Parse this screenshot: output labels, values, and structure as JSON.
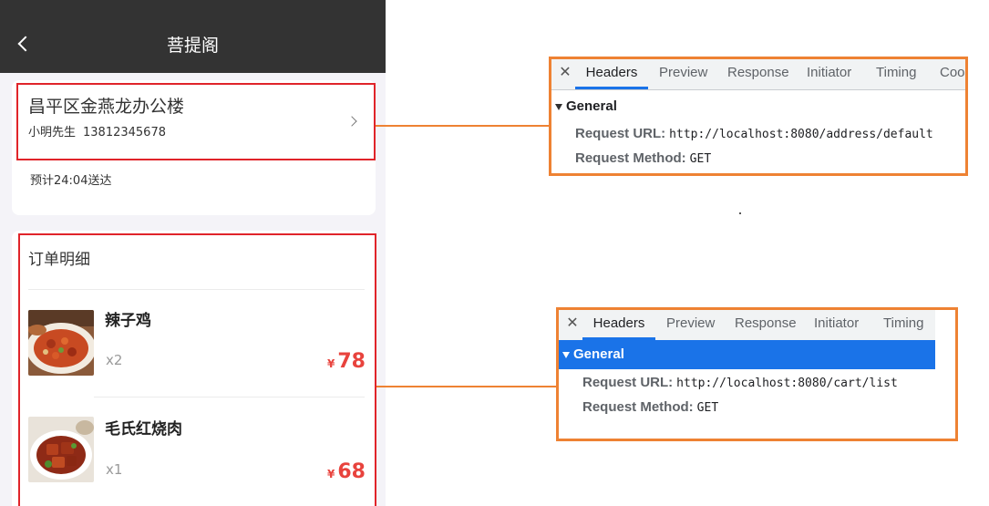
{
  "app": {
    "title": "菩提阁",
    "address": {
      "line": "昌平区金燕龙办公楼",
      "contact_name": "小明先生",
      "contact_phone": "13812345678",
      "eta": "预计24:04送达"
    },
    "order": {
      "title": "订单明细",
      "currency_symbol": "¥",
      "items": [
        {
          "name": "辣子鸡",
          "qty": "x2",
          "price": "78",
          "image": "spicy-chicken-image"
        },
        {
          "name": "毛氏红烧肉",
          "qty": "x1",
          "price": "68",
          "image": "braised-pork-image"
        }
      ]
    }
  },
  "devtools": [
    {
      "tabs": [
        "Headers",
        "Preview",
        "Response",
        "Initiator",
        "Timing",
        "Coo"
      ],
      "active_tab": "Headers",
      "section": "General",
      "request_url_label": "Request URL:",
      "request_url": "http://localhost:8080/address/default",
      "request_method_label": "Request Method:",
      "request_method": "GET"
    },
    {
      "tabs": [
        "Headers",
        "Preview",
        "Response",
        "Initiator",
        "Timing"
      ],
      "active_tab": "Headers",
      "section": "General",
      "request_url_label": "Request URL:",
      "request_url": "http://localhost:8080/cart/list",
      "request_method_label": "Request Method:",
      "request_method": "GET"
    }
  ],
  "colors": {
    "highlight_box": "#e0242a",
    "connector": "#ee8233",
    "price": "#e8433d",
    "devtools_accent": "#1a73e8",
    "nav_bar": "#333333"
  },
  "icons": {
    "back": "chevron-left-icon",
    "address_arrow": "chevron-right-icon",
    "close": "close-icon",
    "expand": "triangle-down-icon"
  }
}
